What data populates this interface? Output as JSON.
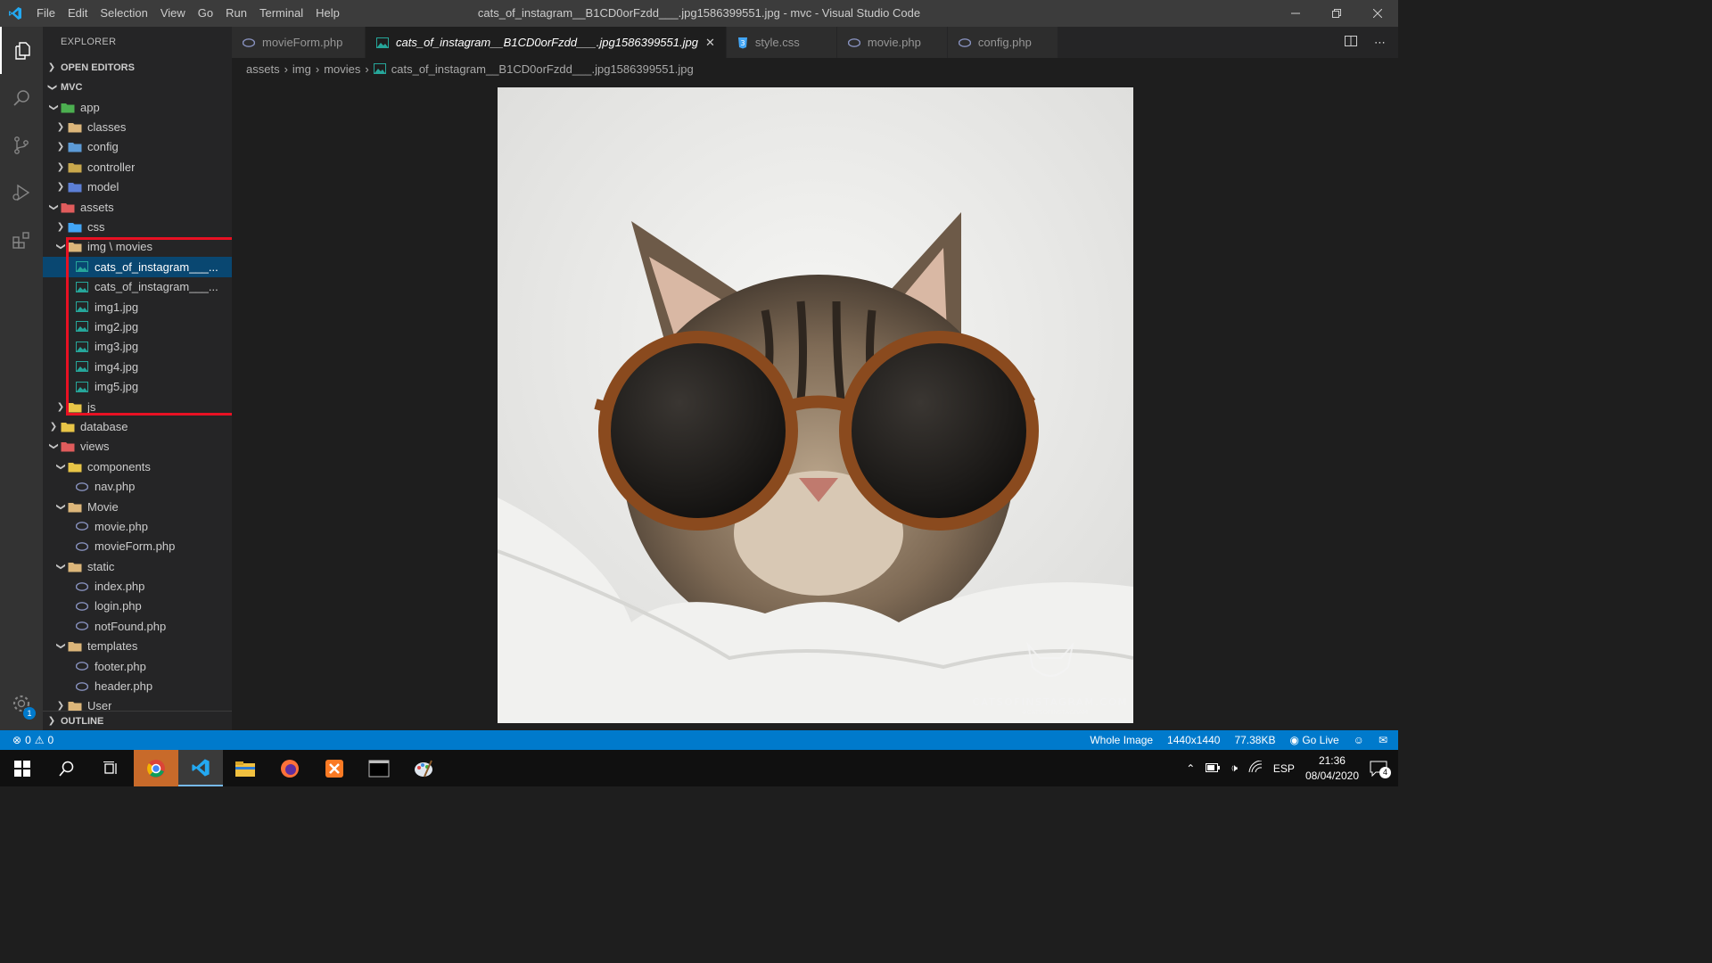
{
  "window": {
    "title": "cats_of_instagram__B1CD0orFzdd___.jpg1586399551.jpg - mvc - Visual Studio Code",
    "menu": [
      "File",
      "Edit",
      "Selection",
      "View",
      "Go",
      "Run",
      "Terminal",
      "Help"
    ]
  },
  "sidebar": {
    "title": "EXPLORER",
    "open_editors": "OPEN EDITORS",
    "project": "MVC",
    "outline": "OUTLINE",
    "tree": [
      {
        "label": "app",
        "indent": 1,
        "twisty": "open",
        "icon": "folder-app-icon",
        "color": "#4caf50"
      },
      {
        "label": "classes",
        "indent": 2,
        "twisty": "closed",
        "icon": "folder-icon",
        "color": "#dcb67a"
      },
      {
        "label": "config",
        "indent": 2,
        "twisty": "closed",
        "icon": "folder-config-icon",
        "color": "#5c9ad6"
      },
      {
        "label": "controller",
        "indent": 2,
        "twisty": "closed",
        "icon": "folder-controller-icon",
        "color": "#c9a84c"
      },
      {
        "label": "model",
        "indent": 2,
        "twisty": "closed",
        "icon": "folder-model-icon",
        "color": "#5c7fd6"
      },
      {
        "label": "assets",
        "indent": 1,
        "twisty": "open",
        "icon": "folder-assets-icon",
        "color": "#e05c5c"
      },
      {
        "label": "css",
        "indent": 2,
        "twisty": "closed",
        "icon": "folder-css-icon",
        "color": "#42a5f5"
      },
      {
        "label": "img \\ movies",
        "indent": 2,
        "twisty": "open",
        "icon": "folder-open-icon",
        "color": "#dcb67a"
      },
      {
        "label": "cats_of_instagram___...",
        "indent": 3,
        "twisty": "none",
        "icon": "image-file-icon",
        "color": "#26a69a",
        "selected": true
      },
      {
        "label": "cats_of_instagram___...",
        "indent": 3,
        "twisty": "none",
        "icon": "image-file-icon",
        "color": "#26a69a"
      },
      {
        "label": "img1.jpg",
        "indent": 3,
        "twisty": "none",
        "icon": "image-file-icon",
        "color": "#26a69a"
      },
      {
        "label": "img2.jpg",
        "indent": 3,
        "twisty": "none",
        "icon": "image-file-icon",
        "color": "#26a69a"
      },
      {
        "label": "img3.jpg",
        "indent": 3,
        "twisty": "none",
        "icon": "image-file-icon",
        "color": "#26a69a"
      },
      {
        "label": "img4.jpg",
        "indent": 3,
        "twisty": "none",
        "icon": "image-file-icon",
        "color": "#26a69a"
      },
      {
        "label": "img5.jpg",
        "indent": 3,
        "twisty": "none",
        "icon": "image-file-icon",
        "color": "#26a69a"
      },
      {
        "label": "js",
        "indent": 2,
        "twisty": "closed",
        "icon": "folder-js-icon",
        "color": "#e8c547"
      },
      {
        "label": "database",
        "indent": 1,
        "twisty": "closed",
        "icon": "folder-database-icon",
        "color": "#e8c547"
      },
      {
        "label": "views",
        "indent": 1,
        "twisty": "open",
        "icon": "folder-views-icon",
        "color": "#e05c5c"
      },
      {
        "label": "components",
        "indent": 2,
        "twisty": "open",
        "icon": "folder-components-icon",
        "color": "#e8c547"
      },
      {
        "label": "nav.php",
        "indent": 3,
        "twisty": "none",
        "icon": "php-file-icon",
        "color": "#8892bf"
      },
      {
        "label": "Movie",
        "indent": 2,
        "twisty": "open",
        "icon": "folder-open-icon",
        "color": "#dcb67a"
      },
      {
        "label": "movie.php",
        "indent": 3,
        "twisty": "none",
        "icon": "php-file-icon",
        "color": "#8892bf"
      },
      {
        "label": "movieForm.php",
        "indent": 3,
        "twisty": "none",
        "icon": "php-file-icon",
        "color": "#8892bf"
      },
      {
        "label": "static",
        "indent": 2,
        "twisty": "open",
        "icon": "folder-open-icon",
        "color": "#dcb67a"
      },
      {
        "label": "index.php",
        "indent": 3,
        "twisty": "none",
        "icon": "php-file-icon",
        "color": "#8892bf"
      },
      {
        "label": "login.php",
        "indent": 3,
        "twisty": "none",
        "icon": "php-file-icon",
        "color": "#8892bf"
      },
      {
        "label": "notFound.php",
        "indent": 3,
        "twisty": "none",
        "icon": "php-file-icon",
        "color": "#8892bf"
      },
      {
        "label": "templates",
        "indent": 2,
        "twisty": "open",
        "icon": "folder-open-icon",
        "color": "#dcb67a"
      },
      {
        "label": "footer.php",
        "indent": 3,
        "twisty": "none",
        "icon": "php-file-icon",
        "color": "#8892bf"
      },
      {
        "label": "header.php",
        "indent": 3,
        "twisty": "none",
        "icon": "php-file-icon",
        "color": "#8892bf"
      },
      {
        "label": "User",
        "indent": 2,
        "twisty": "closed",
        "icon": "folder-icon",
        "color": "#dcb67a"
      }
    ]
  },
  "tabs": [
    {
      "label": "movieForm.php",
      "icon": "php-file-icon",
      "active": false
    },
    {
      "label": "cats_of_instagram__B1CD0orFzdd___.jpg1586399551.jpg",
      "icon": "image-file-icon",
      "active": true
    },
    {
      "label": "style.css",
      "icon": "css-file-icon",
      "active": false
    },
    {
      "label": "movie.php",
      "icon": "php-file-icon",
      "active": false
    },
    {
      "label": "config.php",
      "icon": "php-file-icon",
      "active": false
    }
  ],
  "breadcrumb": [
    "assets",
    "img",
    "movies",
    "cats_of_instagram__B1CD0orFzdd___.jpg1586399551.jpg"
  ],
  "image_preview": {
    "watermark": "CATSOFINSTAGRAM.COM",
    "watermark_tag": "#CATSOFINSTAGRAM"
  },
  "statusbar": {
    "errors": "0",
    "warnings": "0",
    "zoom": "Whole Image",
    "dimensions": "1440x1440",
    "filesize": "77.38KB",
    "golive": "Go Live"
  },
  "taskbar": {
    "lang": "ESP",
    "time": "21:36",
    "date": "08/04/2020",
    "notifications": "4"
  },
  "colors": {
    "accent": "#007acc",
    "highlight_box": "#e81123"
  }
}
